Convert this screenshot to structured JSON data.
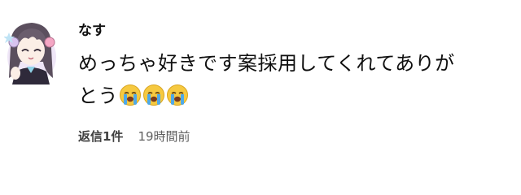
{
  "comment": {
    "username": "なす",
    "text_line1": "めっちゃ好きです案採用してくれてありが",
    "text_line2": "とう",
    "emoji": [
      "loudly-crying-face",
      "loudly-crying-face",
      "loudly-crying-face"
    ],
    "reply_label": "返信1件",
    "timestamp": "19時間前"
  },
  "colors": {
    "text": "#0f0f0f",
    "meta": "#606060",
    "emoji_face": "#f6c940",
    "emoji_tears": "#4fa9e8",
    "avatar_hair": "#5b4f5e",
    "avatar_accent": "#d8c3ef"
  }
}
